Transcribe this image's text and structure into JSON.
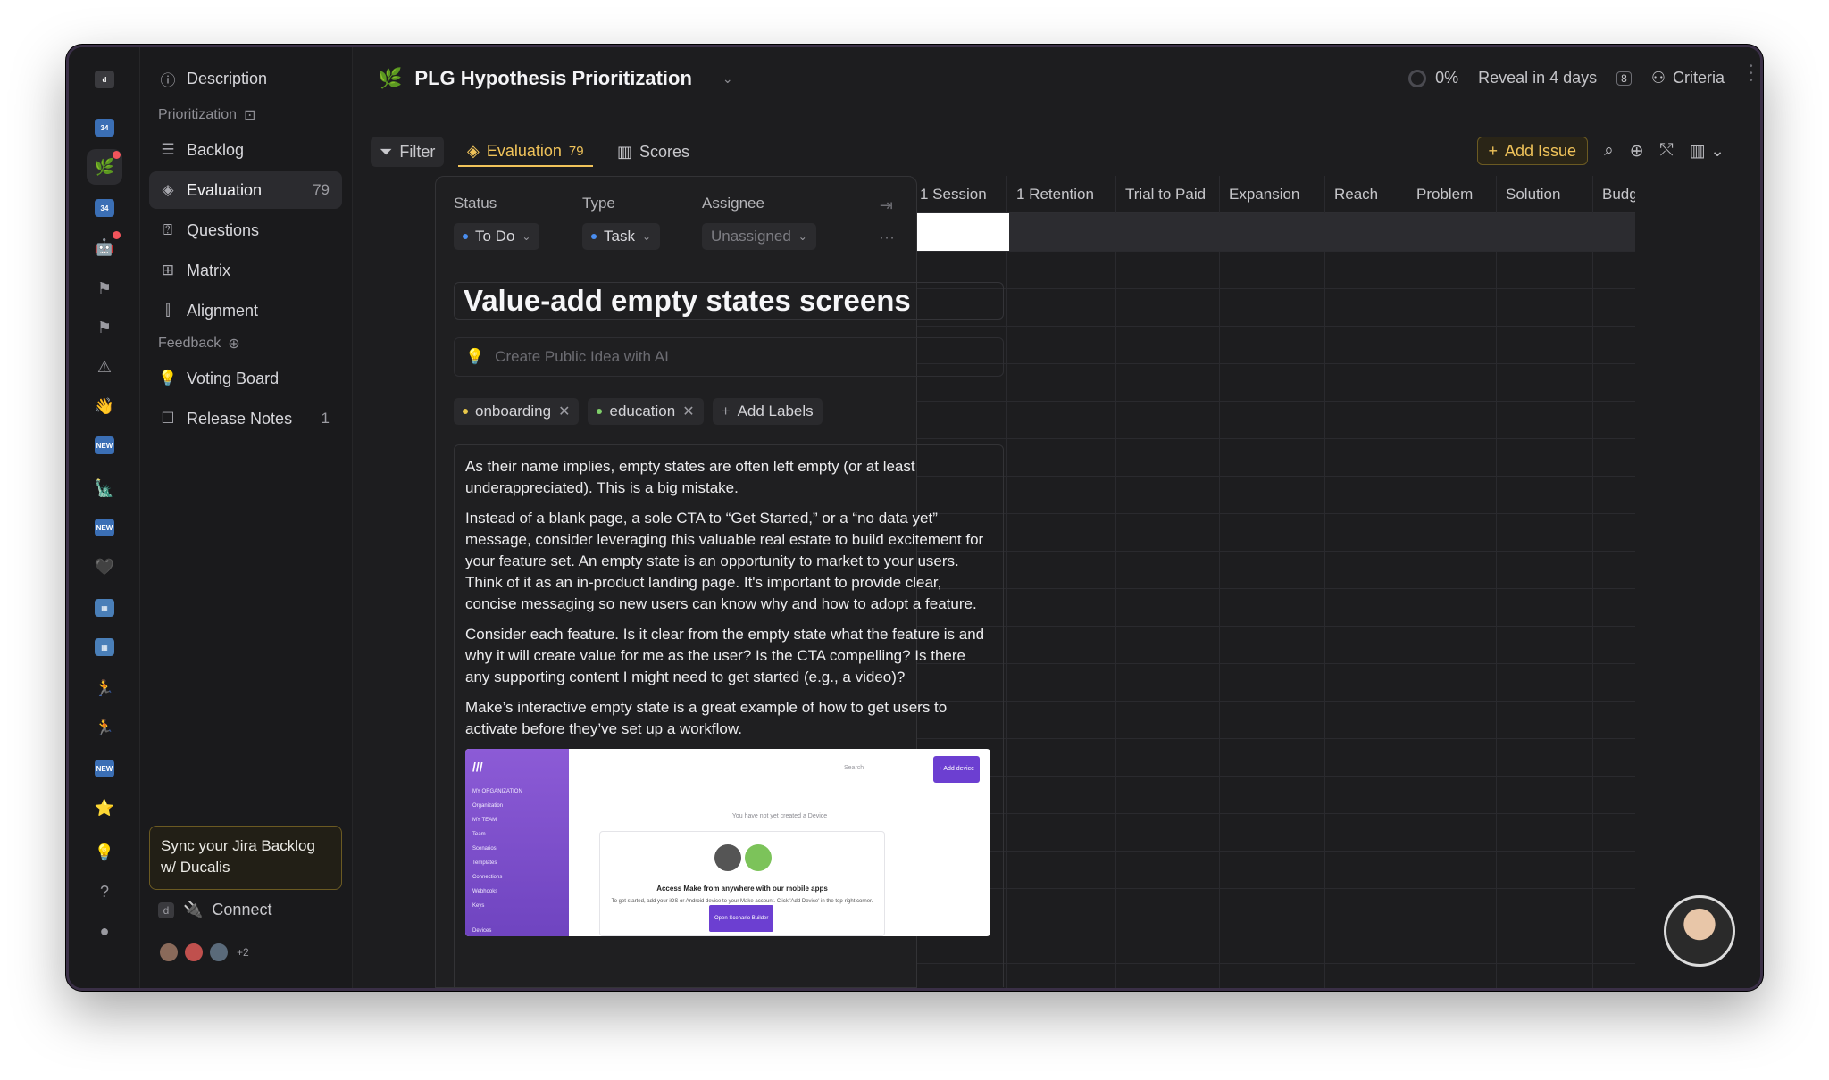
{
  "app": {
    "title": "PLG Hypothesis Prioritization",
    "workspace_letter": "d",
    "progress": "0%",
    "reveal": "Reveal in 4 days",
    "criteria_label": "Criteria"
  },
  "rail": {
    "items": [
      {
        "name": "workspace-logo-icon",
        "glyph": "d",
        "bg": "#3a3a3e"
      },
      {
        "name": "calendar-icon",
        "glyph": "34",
        "bg": "#3b6fb5"
      },
      {
        "name": "seedling-icon",
        "glyph": "🌿",
        "bg": "",
        "active": true,
        "badge": true
      },
      {
        "name": "calendar-icon",
        "glyph": "34",
        "bg": "#3b6fb5"
      },
      {
        "name": "robot-icon",
        "glyph": "🤖",
        "bg": "",
        "badge": true
      },
      {
        "name": "flag-icon",
        "glyph": "⚑",
        "bg": ""
      },
      {
        "name": "flag-icon",
        "glyph": "⚑",
        "bg": ""
      },
      {
        "name": "warning-icon",
        "glyph": "⚠",
        "bg": ""
      },
      {
        "name": "wave-icon",
        "glyph": "👋",
        "bg": ""
      },
      {
        "name": "new-badge-icon",
        "glyph": "NEW",
        "bg": "#3b6fb5"
      },
      {
        "name": "statue-icon",
        "glyph": "🗽",
        "bg": ""
      },
      {
        "name": "new-badge-icon",
        "glyph": "NEW",
        "bg": "#3b6fb5"
      },
      {
        "name": "heart-icon",
        "glyph": "🖤",
        "bg": ""
      },
      {
        "name": "tile-icon",
        "glyph": "▦",
        "bg": "#4a7fb8"
      },
      {
        "name": "tile-icon",
        "glyph": "▦",
        "bg": "#4a7fb8"
      },
      {
        "name": "runner-icon",
        "glyph": "🏃",
        "bg": ""
      },
      {
        "name": "runner-icon",
        "glyph": "🏃",
        "bg": ""
      },
      {
        "name": "new-badge-icon",
        "glyph": "NEW",
        "bg": "#3b6fb5"
      },
      {
        "name": "star-icon",
        "glyph": "⭐",
        "bg": ""
      },
      {
        "name": "lightbulb-icon",
        "glyph": "💡",
        "bg": ""
      },
      {
        "name": "help-icon",
        "glyph": "?",
        "bg": ""
      },
      {
        "name": "user-avatar-icon",
        "glyph": "●",
        "bg": ""
      }
    ]
  },
  "sidebar": {
    "description": "Description",
    "prioritization_section": "Prioritization",
    "nav": [
      {
        "label": "Backlog",
        "icon": "☰",
        "count": ""
      },
      {
        "label": "Evaluation",
        "icon": "◈",
        "count": "79"
      },
      {
        "label": "Questions",
        "icon": "⍰",
        "count": ""
      },
      {
        "label": "Matrix",
        "icon": "⊞",
        "count": ""
      },
      {
        "label": "Alignment",
        "icon": "⫿",
        "count": ""
      }
    ],
    "feedback_section": "Feedback",
    "feedback_nav": [
      {
        "label": "Voting Board",
        "icon": "💡",
        "count": ""
      },
      {
        "label": "Release Notes",
        "icon": "☐",
        "count": "1"
      }
    ],
    "promo": "Sync your Jira Backlog w/ Ducalis",
    "connect": "Connect",
    "avatars_more": "+2"
  },
  "toolbar": {
    "filter": "Filter",
    "evaluation": "Evaluation",
    "evaluation_count": "79",
    "scores": "Scores",
    "add_issue": "Add Issue"
  },
  "grid": {
    "columns": [
      "1 Session",
      "1 Retention",
      "Trial to Paid",
      "Expansion",
      "Reach",
      "Problem",
      "Solution",
      "Budg"
    ]
  },
  "issue": {
    "status_label": "Status",
    "status_value": "To Do",
    "type_label": "Type",
    "type_value": "Task",
    "assignee_label": "Assignee",
    "assignee_value": "Unassigned",
    "title": "Value-add empty states screens",
    "idea_placeholder": "Create Public Idea with AI",
    "labels": [
      "onboarding",
      "education"
    ],
    "add_labels": "Add Labels",
    "description": [
      "As their name implies, empty states are often left empty (or at least underappreciated). This is a big mistake.",
      "Instead of a blank page, a sole CTA to “Get Started,” or a “no data yet” message, consider leveraging this valuable real estate to build excitement for your feature set. An empty state is an opportunity to market to your users. Think of it as an in-product landing page. It's important to provide clear, concise messaging so new users can know why and how to adopt a feature.",
      "Consider each feature. Is it clear from the empty state what the feature is and why it will create value for me as the user? Is the CTA compelling? Is there any supporting content I might need to get started (e.g., a video)?",
      "Make’s interactive empty state is a great example of how to get users to activate before they’ve set up a workflow."
    ],
    "screenshot": {
      "search": "Search",
      "add_device": "+ Add device",
      "empty_text": "You have not yet created a Device",
      "card_title": "Access Make from anywhere with our mobile apps",
      "card_sub": "To get started, add your iOS or Android device to your Make account. Click 'Add Device' in the top-right corner.",
      "card_button": "Open Scenario Builder",
      "nav": [
        "MY ORGANIZATION",
        "Organization",
        "MY TEAM",
        "Team",
        "Scenarios",
        "Templates",
        "Connections",
        "Webhooks",
        "Keys",
        "Devices"
      ]
    }
  },
  "colors": {
    "accent": "#f0c35a",
    "background": "#1d1d1f",
    "label_yellow": "#e9c84a",
    "label_green": "#7fcf6a",
    "status_blue": "#4a8ef0"
  }
}
